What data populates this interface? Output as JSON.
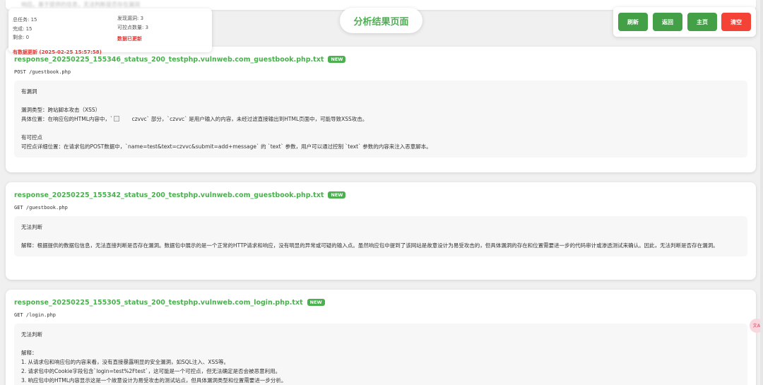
{
  "top_strip_text": "响应。基于提供的信息，无法判断是否存在漏洞",
  "status_panel": {
    "total_tasks": "总任务: 15",
    "completed": "完成: 15",
    "remaining": "剩余: 0",
    "vulns_found": "发现漏洞: 3",
    "controllable_count": "可控点数量: 3",
    "data_updated": "数据已更新"
  },
  "update_notice": "有数据更新 (2025-02-25 15:57:58)",
  "page_title": "分析结果页面",
  "buttons": {
    "refresh": "刷新",
    "back": "返回",
    "home": "主页",
    "clear": "清空"
  },
  "colors": {
    "accent": "#4caf50",
    "danger": "#f44336",
    "alert_text": "#e53935"
  },
  "cards": [
    {
      "title": "response_20250225_155346_status_200_testphp.vulnweb.com_guestbook.php.txt",
      "badge": "NEW",
      "request": "POST /guestbook.php",
      "lines": [
        "有漏洞",
        "",
        "漏洞类型：跨站脚本攻击（XSS）",
        "具体位置：在响应包的HTML内容中，`",
        "",
        "有可控点",
        "可控点详细位置：在请求包的POST数据中，`name=test&text=czvvc&submit=add+message` 的 `text` 参数，用户可以通过控制 `text` 参数的内容来注入恶意脚本。"
      ],
      "line4_tail": "czvvc` 部分，`czvvc` 是用户输入的内容，未经过滤直接输出到HTML页面中，可能导致XSS攻击。"
    },
    {
      "title": "response_20250225_155342_status_200_testphp.vulnweb.com_guestbook.php.txt",
      "badge": "NEW",
      "request": "GET /guestbook.php",
      "lines": [
        "无法判断",
        "",
        "解释：根据提供的数据包信息，无法直接判断是否存在漏洞。数据包中展示的是一个正常的HTTP请求和响应，没有明显的异常或可疑的输入点。虽然响应包中提到了该网站是故意设计为易受攻击的，但具体漏洞的存在和位置需要进一步的代码审计或渗透测试来确认。因此，无法判断是否存在漏洞。"
      ]
    },
    {
      "title": "response_20250225_155305_status_200_testphp.vulnweb.com_login.php.txt",
      "badge": "NEW",
      "request": "GET /login.php",
      "lines": [
        "无法判断",
        "",
        "解释：",
        "1. 从请求包和响应包的内容来看，没有直接暴露明显的安全漏洞，如SQL注入、XSS等。",
        "2. 请求包中的Cookie字段包含`login=test%2Ftest`，这可能是一个可控点，但无法确定是否会被恶意利用。",
        "3. 响应包中的HTML内容显示这是一个故意设计为易受攻击的测试站点，但具体漏洞类型和位置需要进一步分析。"
      ]
    }
  ],
  "translate_fab": "文A"
}
